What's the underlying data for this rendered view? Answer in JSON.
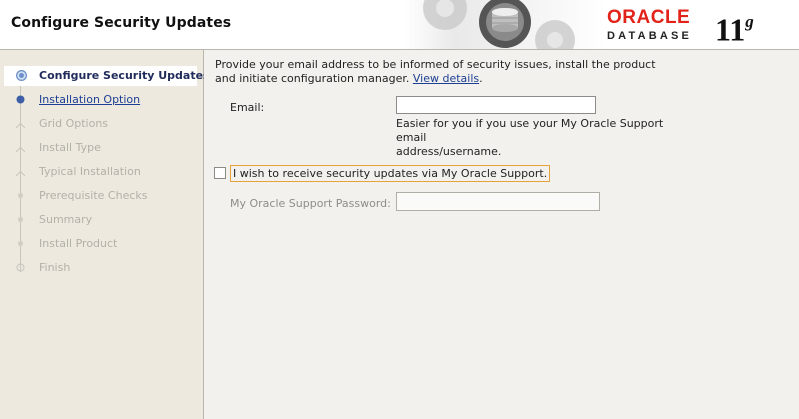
{
  "header": {
    "title": "Configure Security Updates",
    "brand": "ORACLE",
    "product": "DATABASE",
    "version": "11",
    "version_suffix": "g",
    "brand_color": "#e2231a"
  },
  "steps": [
    {
      "label": "Configure Security Updates",
      "state": "active"
    },
    {
      "label": "Installation Option",
      "state": "link"
    },
    {
      "label": "Grid Options",
      "state": "disabled"
    },
    {
      "label": "Install Type",
      "state": "disabled"
    },
    {
      "label": "Typical Installation",
      "state": "disabled"
    },
    {
      "label": "Prerequisite Checks",
      "state": "disabled"
    },
    {
      "label": "Summary",
      "state": "disabled"
    },
    {
      "label": "Install Product",
      "state": "disabled"
    },
    {
      "label": "Finish",
      "state": "disabled"
    }
  ],
  "main": {
    "intro_line1": "Provide your email address to be informed of security issues, install the product",
    "intro_line2": "and initiate configuration manager.",
    "view_details": "View details",
    "intro_end": ".",
    "email_label": "Email:",
    "email_value": "",
    "email_hint_line1": "Easier for you if you use your My Oracle Support email",
    "email_hint_line2": "address/username.",
    "checkbox_label": "I wish to receive security updates via My Oracle Support.",
    "checkbox_checked": false,
    "password_label": "My Oracle Support Password:",
    "password_value": ""
  }
}
